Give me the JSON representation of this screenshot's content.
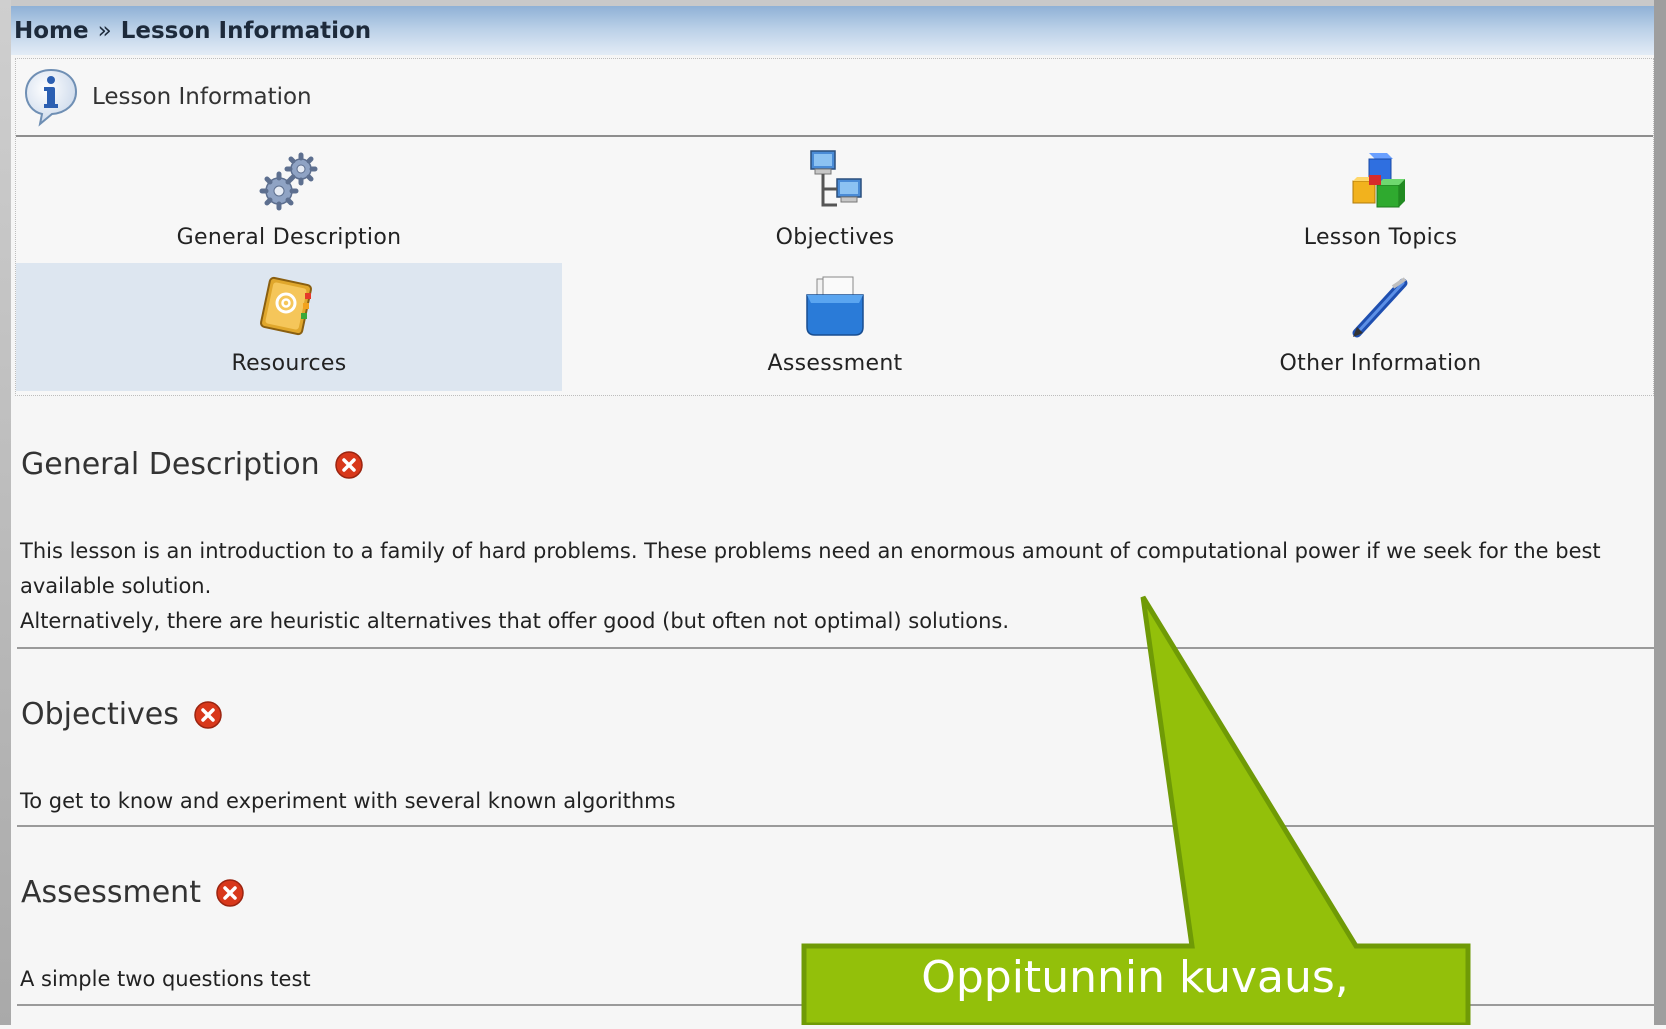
{
  "breadcrumb": {
    "home": "Home",
    "separator": "»",
    "current": "Lesson Information"
  },
  "panel": {
    "title": "Lesson Information",
    "items": [
      {
        "label": "General Description",
        "icon": "gears-icon"
      },
      {
        "label": "Objectives",
        "icon": "network-computers-icon"
      },
      {
        "label": "Lesson Topics",
        "icon": "blocks-icon"
      },
      {
        "label": "Resources",
        "icon": "address-book-icon",
        "active": true
      },
      {
        "label": "Assessment",
        "icon": "folder-box-icon"
      },
      {
        "label": "Other Information",
        "icon": "pen-icon"
      }
    ]
  },
  "sections": [
    {
      "title": "General Description",
      "lines": [
        "This lesson is an introduction to a family of hard problems. These problems need an enormous amount of computational power if we seek for the best available solution.",
        "Alternatively, there are heuristic alternatives that offer good (but often not optimal) solutions."
      ]
    },
    {
      "title": "Objectives",
      "lines": [
        "To get to know and experiment with several known algorithms"
      ]
    },
    {
      "title": "Assessment",
      "lines": [
        "A simple two questions test"
      ]
    }
  ],
  "callout": {
    "text": "Oppitunnin kuvaus,",
    "color": "#93c00a",
    "border_color": "#6f9a06"
  },
  "colors": {
    "delete_icon": "#d8381b",
    "active_cell": "#dde6f0",
    "breadcrumb_bar": "#a9c3e0"
  }
}
